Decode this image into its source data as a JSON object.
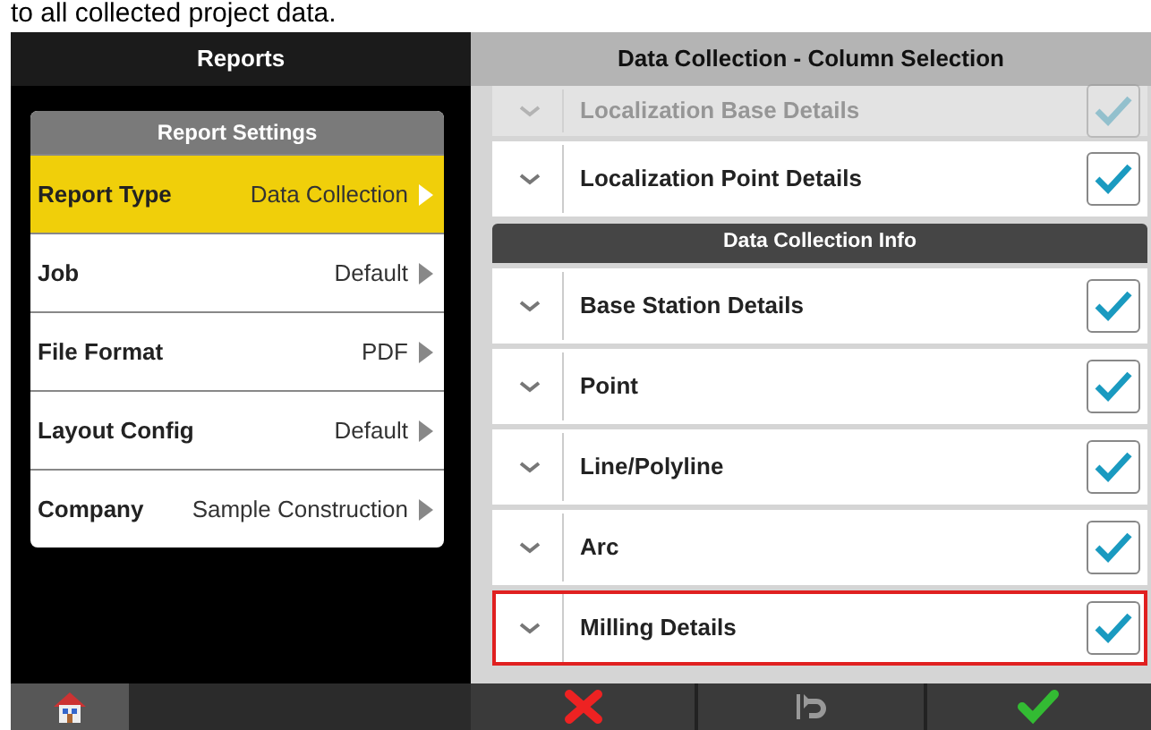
{
  "caption": "to all collected project data.",
  "left_panel": {
    "title": "Reports",
    "settings": {
      "title": "Report Settings",
      "rows": [
        {
          "label": "Report Type",
          "value": "Data Collection",
          "selected": true
        },
        {
          "label": "Job",
          "value": "Default",
          "selected": false
        },
        {
          "label": "File Format",
          "value": "PDF",
          "selected": false
        },
        {
          "label": "Layout Config",
          "value": "Default",
          "selected": false
        },
        {
          "label": "Company",
          "value": "Sample Construction",
          "selected": false
        }
      ]
    }
  },
  "right_panel": {
    "title": "Data Collection - Column Selection",
    "rows": [
      {
        "kind": "item",
        "label": "Localization Base Details",
        "checked": true,
        "faded": true,
        "highlighted": false
      },
      {
        "kind": "item",
        "label": "Localization Point Details",
        "checked": true,
        "faded": false,
        "highlighted": false
      },
      {
        "kind": "section",
        "label": "Data Collection Info"
      },
      {
        "kind": "item",
        "label": "Base Station Details",
        "checked": true,
        "faded": false,
        "highlighted": false
      },
      {
        "kind": "item",
        "label": "Point",
        "checked": true,
        "faded": false,
        "highlighted": false
      },
      {
        "kind": "item",
        "label": "Line/Polyline",
        "checked": true,
        "faded": false,
        "highlighted": false
      },
      {
        "kind": "item",
        "label": "Arc",
        "checked": true,
        "faded": false,
        "highlighted": false
      },
      {
        "kind": "item",
        "label": "Milling Details",
        "checked": true,
        "faded": false,
        "highlighted": true
      }
    ]
  },
  "bottom_bar": {
    "left": [
      {
        "kind": "home"
      }
    ],
    "right": [
      {
        "kind": "cancel"
      },
      {
        "kind": "undo"
      },
      {
        "kind": "accept"
      }
    ]
  }
}
